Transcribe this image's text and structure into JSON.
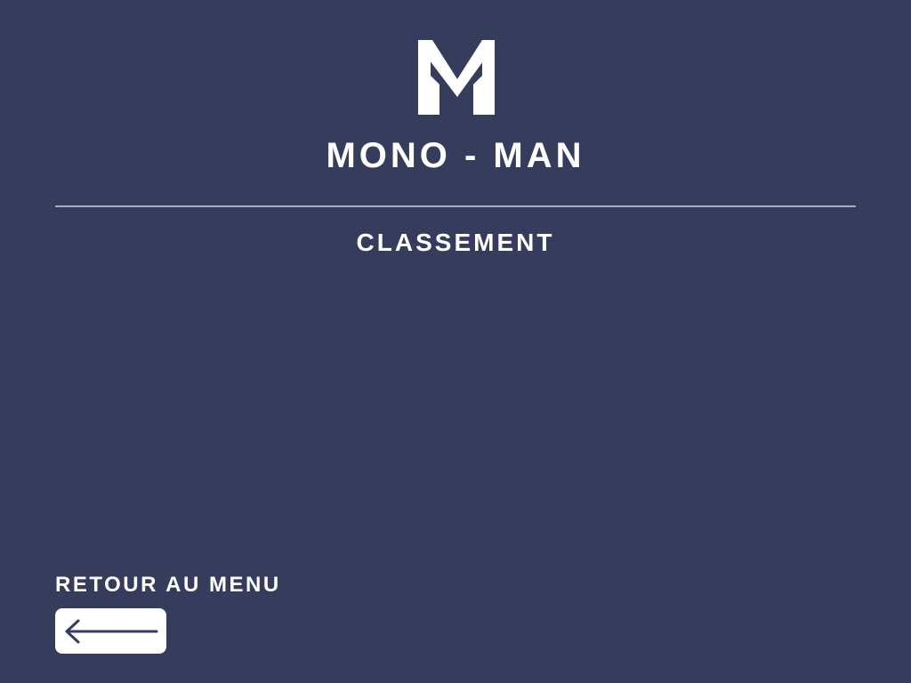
{
  "colors": {
    "background": "#353c5c",
    "text": "#ffffff",
    "divider": "#a5aac2",
    "button_background": "#ffffff",
    "arrow": "#353c5c"
  },
  "brand": {
    "logo_icon": "mm-monogram-logo",
    "title": "MONO - MAN"
  },
  "page": {
    "section_title": "CLASSEMENT"
  },
  "footer": {
    "back_label": "RETOUR AU MENU",
    "back_icon": "arrow-left-icon"
  }
}
